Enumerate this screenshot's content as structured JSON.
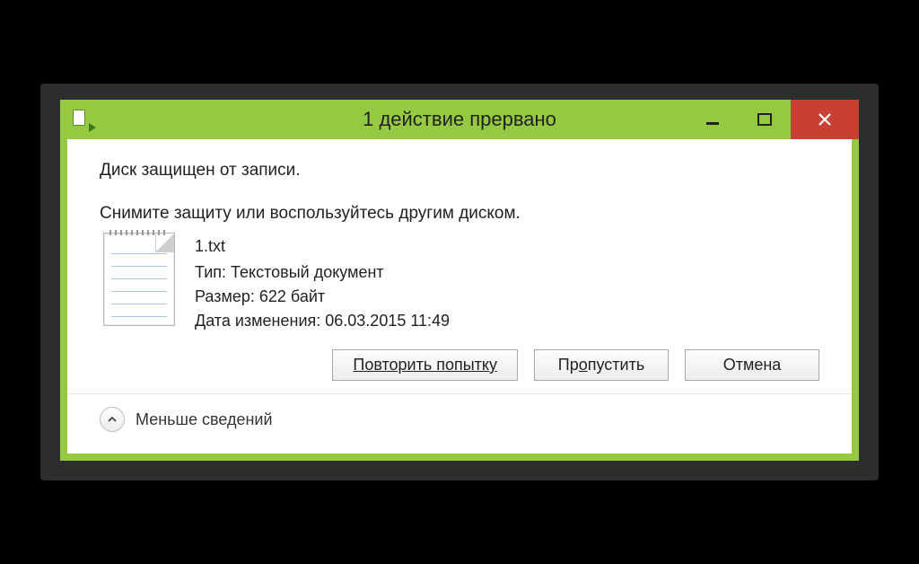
{
  "titlebar": {
    "title": "1 действие прервано"
  },
  "content": {
    "error_heading": "Диск защищен от записи.",
    "instruction": "Снимите защиту или воспользуйтесь другим диском.",
    "file": {
      "name": "1.txt",
      "type_label": "Тип:",
      "type_value": "Текстовый документ",
      "size_label": "Размер:",
      "size_value": "622 байт",
      "modified_label": "Дата изменения:",
      "modified_value": "06.03.2015 11:49"
    }
  },
  "buttons": {
    "retry": "Повторить попытку",
    "skip_prefix": "Пр",
    "skip_ul": "о",
    "skip_suffix": "пустить",
    "cancel": "Отмена"
  },
  "footer": {
    "less_details": "Меньше сведений"
  }
}
